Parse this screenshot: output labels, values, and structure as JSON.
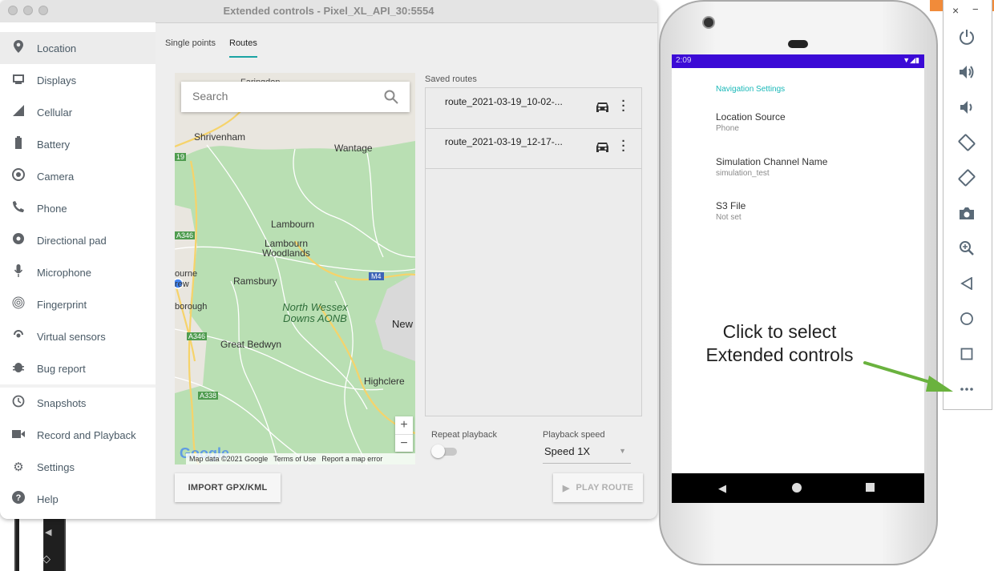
{
  "window": {
    "title": "Extended controls - Pixel_XL_API_30:5554"
  },
  "sidebar": {
    "items": [
      {
        "label": "Location",
        "icon": "location-pin-icon",
        "active": true
      },
      {
        "label": "Displays",
        "icon": "display-icon"
      },
      {
        "label": "Cellular",
        "icon": "signal-icon"
      },
      {
        "label": "Battery",
        "icon": "battery-icon"
      },
      {
        "label": "Camera",
        "icon": "camera-icon"
      },
      {
        "label": "Phone",
        "icon": "phone-icon"
      },
      {
        "label": "Directional pad",
        "icon": "dpad-icon"
      },
      {
        "label": "Microphone",
        "icon": "microphone-icon"
      },
      {
        "label": "Fingerprint",
        "icon": "fingerprint-icon"
      },
      {
        "label": "Virtual sensors",
        "icon": "sensors-icon"
      },
      {
        "label": "Bug report",
        "icon": "bug-icon"
      },
      {
        "label": "Snapshots",
        "icon": "history-icon"
      },
      {
        "label": "Record and Playback",
        "icon": "video-icon"
      },
      {
        "label": "Settings",
        "icon": "gear-icon"
      },
      {
        "label": "Help",
        "icon": "help-icon"
      }
    ]
  },
  "tabs": {
    "single_points": "Single points",
    "routes": "Routes"
  },
  "map": {
    "search_placeholder": "Search",
    "zoom_in": "+",
    "zoom_out": "−",
    "google": "Google",
    "attribution": {
      "data": "Map data ©2021 Google",
      "terms": "Terms of Use",
      "report": "Report a map error"
    },
    "labels": [
      "Faringdon",
      "Shrivenham",
      "Wantage",
      "Lambourn",
      "Lambourn Woodlands",
      "Ramsbury",
      "North Wessex Downs AONB",
      "New",
      "Great Bedwyn",
      "Highclere",
      "A346",
      "A346",
      "A338",
      "M4",
      "19",
      "ourne",
      "rew",
      "borough"
    ]
  },
  "saved_routes": {
    "label": "Saved routes",
    "routes": [
      {
        "name": "route_2021-03-19_10-02-..."
      },
      {
        "name": "route_2021-03-19_12-17-..."
      }
    ]
  },
  "playback": {
    "repeat_label": "Repeat playback",
    "repeat_on": false,
    "speed_label": "Playback speed",
    "speed_value": "Speed 1X"
  },
  "buttons": {
    "import": "IMPORT GPX/KML",
    "play": "PLAY ROUTE"
  },
  "device": {
    "status_time": "2:09",
    "settings_header": "Navigation Settings",
    "settings": [
      {
        "title": "Location Source",
        "value": "Phone"
      },
      {
        "title": "Simulation Channel Name",
        "value": "simulation_test"
      },
      {
        "title": "S3 File",
        "value": "Not set"
      }
    ]
  },
  "emulator_toolbar": {
    "close": "×",
    "minimize": "−",
    "buttons": [
      "power-icon",
      "volume-up-icon",
      "volume-down-icon",
      "rotate-left-icon",
      "rotate-right-icon",
      "screenshot-icon",
      "zoom-icon",
      "back-icon",
      "home-icon",
      "overview-icon",
      "more-icon"
    ]
  },
  "annotation": {
    "line1": "Click to select",
    "line2": "Extended controls"
  },
  "colors": {
    "accent": "#1aa3a3",
    "map_green": "#b9dfb3",
    "status_bar": "#3b0ad6",
    "arrow": "#6ab23e",
    "orange": "#f18b3a"
  }
}
